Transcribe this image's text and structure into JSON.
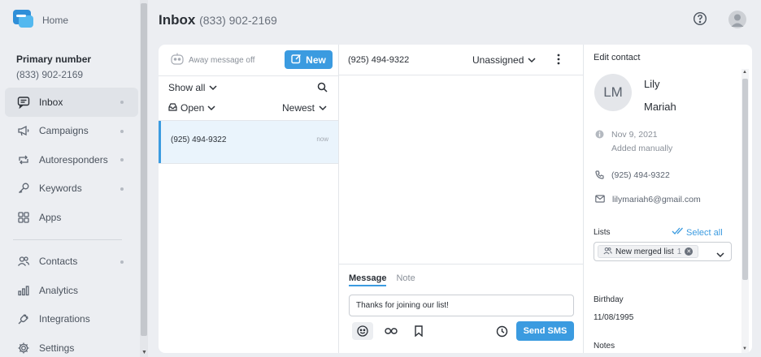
{
  "sidebar": {
    "home_label": "Home",
    "primary_title": "Primary number",
    "primary_number": "(833) 902-2169",
    "items": [
      {
        "label": "Inbox",
        "icon": "chat-bubble-icon"
      },
      {
        "label": "Campaigns",
        "icon": "megaphone-icon"
      },
      {
        "label": "Autoresponders",
        "icon": "arrows-cycle-icon"
      },
      {
        "label": "Keywords",
        "icon": "key-icon"
      },
      {
        "label": "Apps",
        "icon": "grid-icon"
      },
      {
        "label": "Contacts",
        "icon": "contacts-icon"
      },
      {
        "label": "Analytics",
        "icon": "bar-chart-icon"
      },
      {
        "label": "Integrations",
        "icon": "plug-icon"
      },
      {
        "label": "Settings",
        "icon": "gear-icon"
      }
    ]
  },
  "header": {
    "title": "Inbox",
    "number": "(833) 902-2169"
  },
  "list": {
    "away": "Away message off",
    "new_label": "New",
    "filter_show": "Show all",
    "filter_status": "Open",
    "sort": "Newest",
    "items": [
      {
        "phone": "(925) 494-9322",
        "time": "now"
      }
    ]
  },
  "conversation": {
    "phone": "(925) 494-9322",
    "assignee": "Unassigned",
    "tab_message": "Message",
    "tab_note": "Note",
    "message_text": "Thanks for joining our list!",
    "send_label": "Send SMS"
  },
  "contact": {
    "title": "Edit contact",
    "initials": "LM",
    "first_name": "Lily",
    "last_name": "Mariah",
    "added_date": "Nov 9, 2021",
    "added_via": "Added manually",
    "phone": "(925) 494-9322",
    "email": "lilymariah6@gmail.com",
    "lists_label": "Lists",
    "select_all": "Select all",
    "list_chip": "New merged list",
    "list_chip_count": "1",
    "birthday_label": "Birthday",
    "birthday": "11/08/1995",
    "notes_label": "Notes"
  },
  "colors": {
    "accent": "#3b9be0",
    "background": "#eceef2"
  }
}
